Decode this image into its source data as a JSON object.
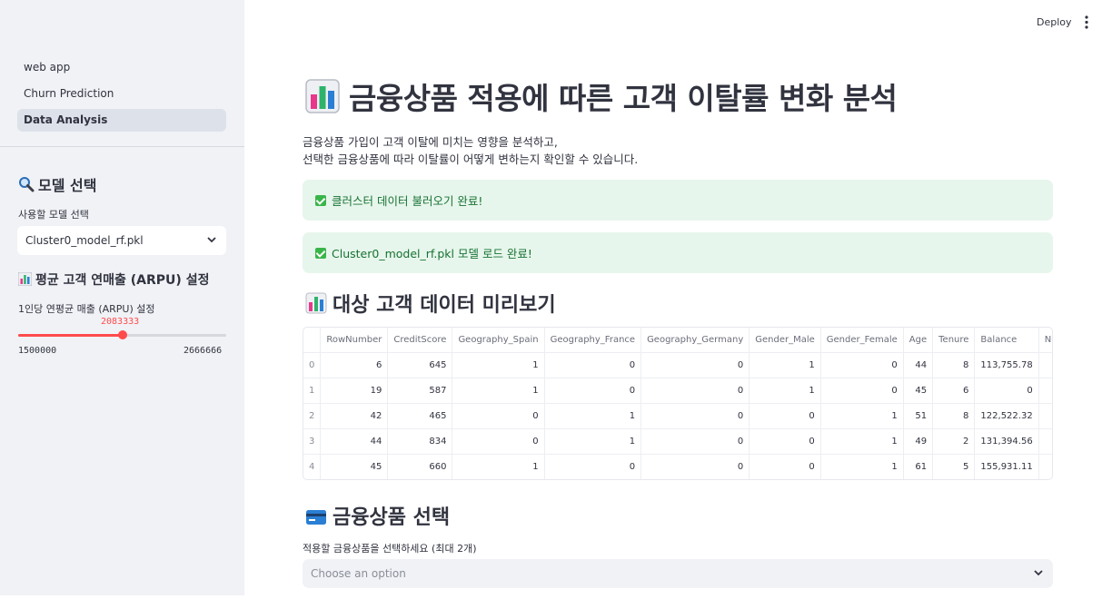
{
  "sidebar": {
    "nav": [
      "web app",
      "Churn Prediction",
      "Data Analysis"
    ],
    "model_header": "모델 선택",
    "model_label": "사용할 모델 선택",
    "model_value": "Cluster0_model_rf.pkl",
    "arpu_header": "평균 고객 연매출 (ARPU) 설정",
    "arpu_label": "1인당 연평균 매출 (ARPU) 설정",
    "slider": {
      "value": "2083333",
      "min": "1500000",
      "max": "2666666",
      "fraction": 0.5
    }
  },
  "header": {
    "deploy": "Deploy"
  },
  "main": {
    "title": "금융상품 적용에 따른 고객 이탈률 변화 분석",
    "desc1": "금융상품 가입이 고객 이탈에 미치는 영향을 분석하고,",
    "desc2": "선택한 금융상품에 따라 이탈률이 어떻게 변하는지 확인할 수 있습니다.",
    "alert1": "클러스터 데이터 불러오기 완료!",
    "alert2": "Cluster0_model_rf.pkl 모델 로드 완료!",
    "preview_header": "대상 고객 데이터 미리보기",
    "table": {
      "columns": [
        "",
        "RowNumber",
        "CreditScore",
        "Geography_Spain",
        "Geography_France",
        "Geography_Germany",
        "Gender_Male",
        "Gender_Female",
        "Age",
        "Tenure",
        "Balance",
        "Nur"
      ],
      "rows": [
        [
          "0",
          "6",
          "645",
          "1",
          "0",
          "0",
          "1",
          "0",
          "44",
          "8",
          "113,755.78",
          ""
        ],
        [
          "1",
          "19",
          "587",
          "1",
          "0",
          "0",
          "1",
          "0",
          "45",
          "6",
          "0",
          ""
        ],
        [
          "2",
          "42",
          "465",
          "0",
          "1",
          "0",
          "0",
          "1",
          "51",
          "8",
          "122,522.32",
          ""
        ],
        [
          "3",
          "44",
          "834",
          "0",
          "1",
          "0",
          "0",
          "1",
          "49",
          "2",
          "131,394.56",
          ""
        ],
        [
          "4",
          "45",
          "660",
          "1",
          "0",
          "0",
          "0",
          "1",
          "61",
          "5",
          "155,931.11",
          ""
        ]
      ]
    },
    "product_header": "금융상품 선택",
    "product_label": "적용할 금융상품을 선택하세요 (최대 2개)",
    "product_placeholder": "Choose an option"
  },
  "icons": {
    "model": "magnifier-icon",
    "arpu": "bar-chart-icon",
    "title": "bar-chart-icon",
    "preview": "bar-chart-icon",
    "product": "credit-card-icon",
    "success": "check-box-icon"
  },
  "colors": {
    "accent": "#ff4b4b",
    "success_bg": "#e7f6ec",
    "success_text": "#177233"
  }
}
